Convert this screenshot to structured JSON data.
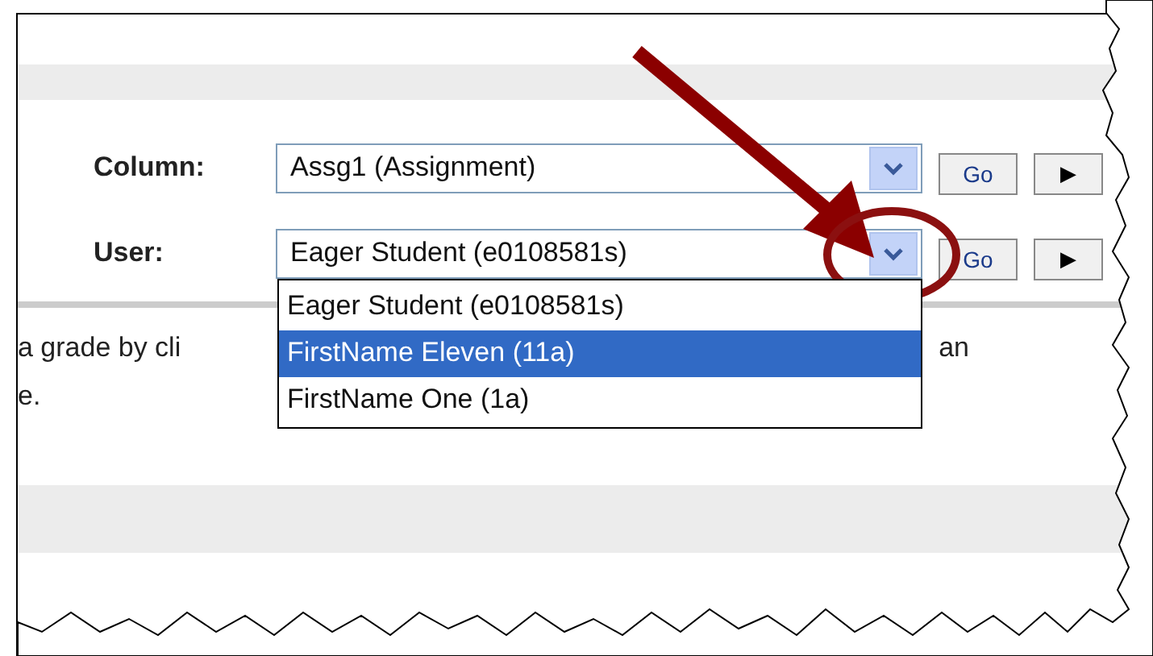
{
  "form": {
    "rows": [
      {
        "label": "Column:",
        "value": "Assg1 (Assignment)",
        "buttons": [
          "Go",
          "▶"
        ],
        "options": []
      },
      {
        "label": "User:",
        "value": "Eager Student (e0108581s)",
        "buttons": [
          "Go",
          "▶"
        ],
        "options": [
          {
            "label": "Eager Student (e0108581s)",
            "highlighted": false
          },
          {
            "label": "FirstName Eleven (11a)",
            "highlighted": true
          },
          {
            "label": "FirstName One (1a)",
            "highlighted": false
          }
        ]
      }
    ]
  },
  "instructions": {
    "lines": [
      [
        "a grade by cli",
        "an"
      ],
      [
        "e."
      ]
    ]
  }
}
